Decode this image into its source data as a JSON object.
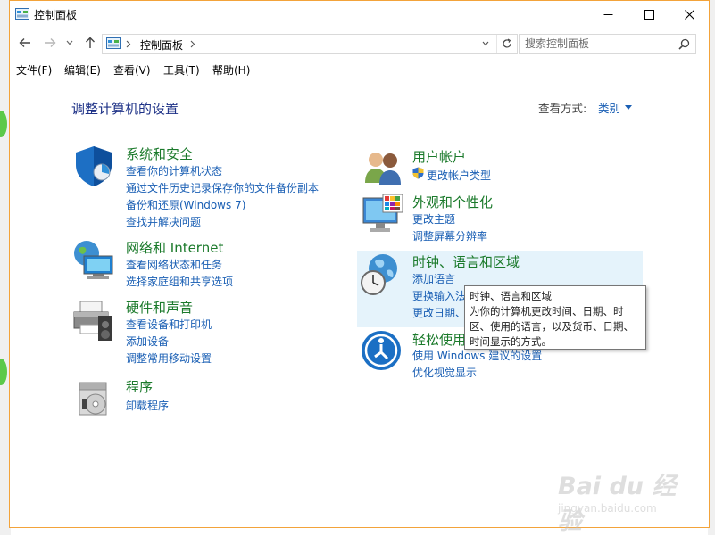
{
  "window": {
    "title": "控制面板"
  },
  "nav": {
    "address_path": "控制面板",
    "search_placeholder": "搜索控制面板"
  },
  "menu": [
    "文件(F)",
    "编辑(E)",
    "查看(V)",
    "工具(T)",
    "帮助(H)"
  ],
  "header": {
    "title": "调整计算机的设置",
    "view_by_label": "查看方式:",
    "view_by_value": "类别"
  },
  "categories": {
    "system": {
      "title": "系统和安全",
      "links": [
        "查看你的计算机状态",
        "通过文件历史记录保存你的文件备份副本",
        "备份和还原(Windows 7)",
        "查找并解决问题"
      ]
    },
    "network": {
      "title": "网络和 Internet",
      "links": [
        "查看网络状态和任务",
        "选择家庭组和共享选项"
      ]
    },
    "hardware": {
      "title": "硬件和声音",
      "links": [
        "查看设备和打印机",
        "添加设备",
        "调整常用移动设置"
      ]
    },
    "programs": {
      "title": "程序",
      "links": [
        "卸载程序"
      ]
    },
    "accounts": {
      "title": "用户帐户",
      "links": [
        "更改帐户类型"
      ]
    },
    "appearance": {
      "title": "外观和个性化",
      "links": [
        "更改主题",
        "调整屏幕分辨率"
      ]
    },
    "clock": {
      "title": "时钟、语言和区域",
      "links": [
        "添加语言",
        "更换输入法",
        "更改日期、"
      ]
    },
    "ease": {
      "title": "轻松使用",
      "links": [
        "使用 Windows 建议的设置",
        "优化视觉显示"
      ]
    }
  },
  "tooltip": {
    "lines": [
      "时钟、语言和区域",
      "为你的计算机更改时间、日期、时",
      "区、使用的语言，以及货币、日期、",
      "时间显示的方式。"
    ]
  },
  "watermark": {
    "main": "Bai du 经验",
    "sub": "jingyan.baidu.com"
  },
  "colors": {
    "link": "#1a5fb4",
    "category_title": "#1b7a2b",
    "heading": "#1e3287",
    "hover": "#e5f3fb",
    "window_border": "#f3a33a"
  }
}
